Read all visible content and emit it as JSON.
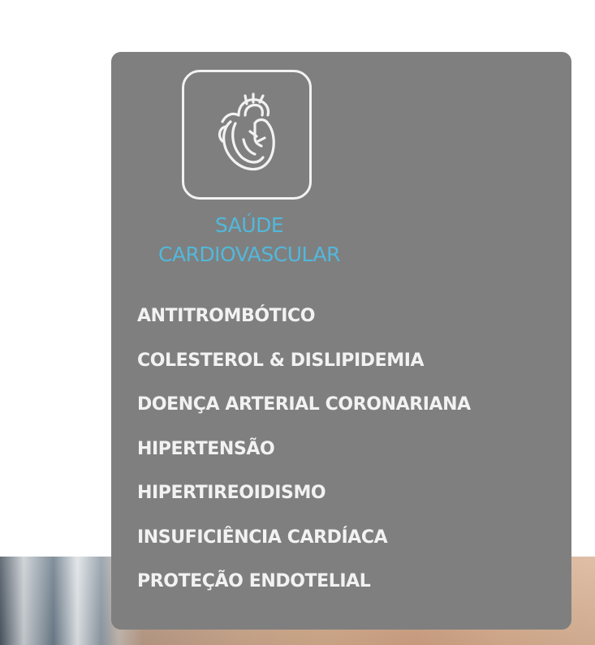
{
  "menu": {
    "category": {
      "icon": "heart-icon",
      "title_line1": "SAÚDE",
      "title_line2": "CARDIOVASCULAR"
    },
    "items": [
      {
        "label": "ANTITROMBÓTICO"
      },
      {
        "label": "COLESTEROL & DISLIPIDEMIA"
      },
      {
        "label": "DOENÇA ARTERIAL CORONARIANA"
      },
      {
        "label": "HIPERTENSÃO"
      },
      {
        "label": "HIPERTIREOIDISMO"
      },
      {
        "label": "INSUFICIÊNCIA CARDÍACA"
      },
      {
        "label": "PROTEÇÃO ENDOTELIAL"
      }
    ]
  },
  "colors": {
    "panel": "#7f7f7f",
    "title": "#52b8db",
    "item_text": "#f2f2f2",
    "icon_stroke": "#f2f2f2"
  }
}
